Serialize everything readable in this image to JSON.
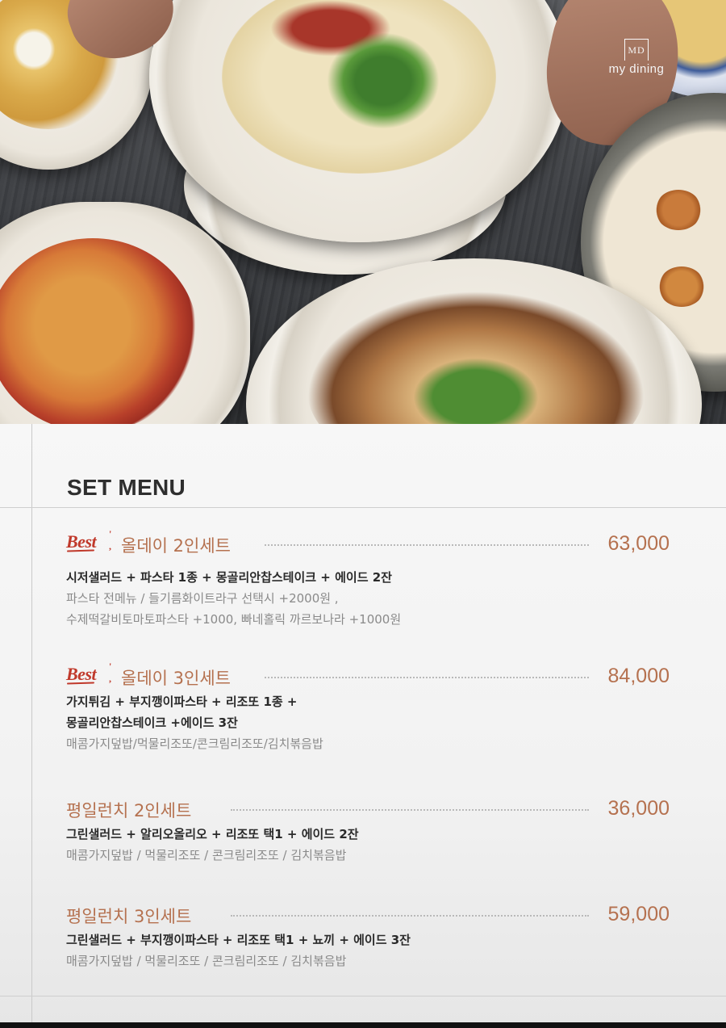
{
  "brand": {
    "logo_text": "my dining",
    "logo_mark": "MD"
  },
  "section_title": "SET MENU",
  "items": [
    {
      "badge": "Best",
      "name": "올데이 2인세트",
      "price": "63,000",
      "main": [
        "시저샐러드 + 파스타 1종 + 몽골리안찹스테이크 + 에이드 2잔"
      ],
      "options": [
        "파스타 전메뉴 / 들기름화이트라구 선택시 +2000원 ,",
        "수제떡갈비토마토파스타 +1000, 빠네홀릭 까르보나라 +1000원"
      ]
    },
    {
      "badge": "Best",
      "name": "올데이 3인세트",
      "price": "84,000",
      "main": [
        "가지튀김 + 부지깽이파스타 + 리조또 1종 +",
        "몽골리안찹스테이크 +에이드 3잔"
      ],
      "options": [
        "매콤가지덮밥/먹물리조또/콘크림리조또/김치볶음밥"
      ]
    },
    {
      "badge": "",
      "name": "평일런치 2인세트",
      "price": "36,000",
      "main": [
        "그린샐러드 + 알리오올리오 + 리조또 택1 + 에이드 2잔"
      ],
      "options": [
        "매콤가지덮밥 / 먹물리조또 / 콘크림리조또 / 김치볶음밥"
      ]
    },
    {
      "badge": "",
      "name": "평일런치 3인세트",
      "price": "59,000",
      "main": [
        "그린샐러드 + 부지깽이파스타 + 리조또 택1 + 뇨끼 + 에이드 3잔"
      ],
      "options": [
        "매콤가지덮밥 / 먹물리조또 / 콘크림리조또 / 김치볶음밥"
      ]
    }
  ],
  "colors": {
    "accent": "#b5714f",
    "badge": "#c0392b",
    "title": "#2e2e2e"
  }
}
